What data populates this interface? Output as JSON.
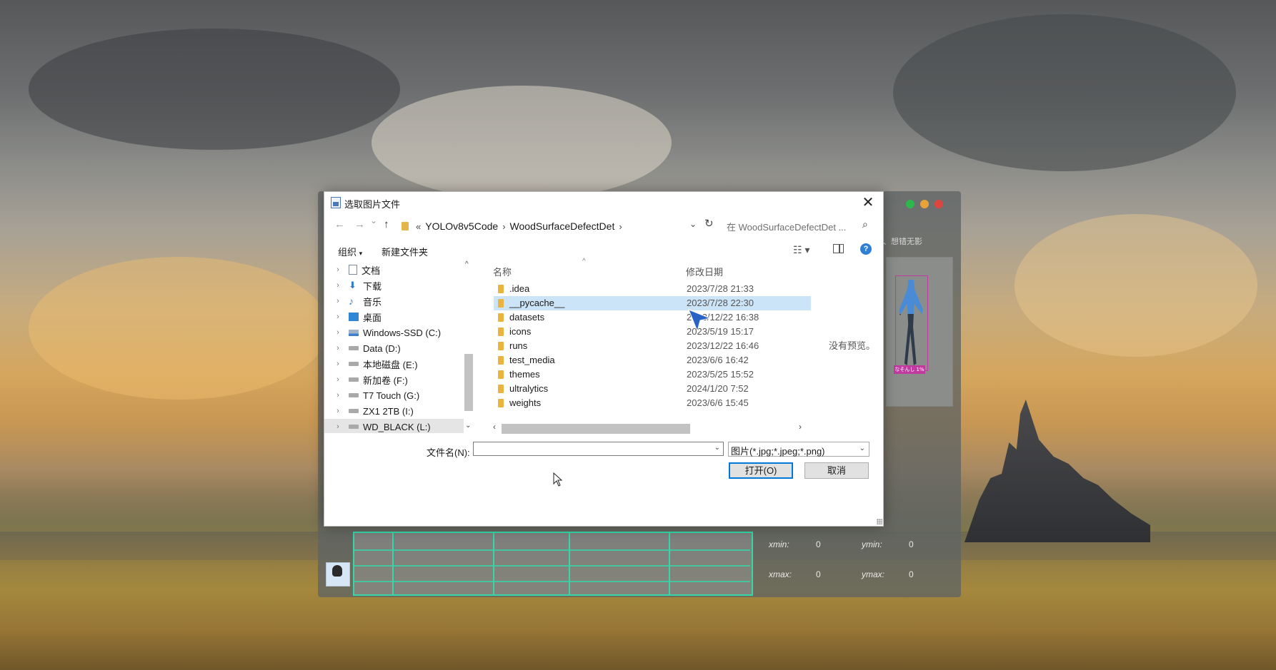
{
  "dialog": {
    "title": "选取图片文件",
    "close_glyph": "✕"
  },
  "navigation": {
    "back_glyph": "←",
    "forward_glyph": "→",
    "history_glyph": "⌄",
    "up_glyph": "↑",
    "crumb_prefix": "«",
    "breadcrumbs": [
      "YOLOv8v5Code",
      "WoodSurfaceDefectDet"
    ],
    "crumb_sep": "›",
    "dropdown_glyph": "⌄",
    "refresh_glyph": "↻",
    "search_placeholder": "在 WoodSurfaceDefectDet ...",
    "search_glyph": "⌕"
  },
  "toolbar": {
    "organize_label": "组织",
    "organize_caret": "▾",
    "new_folder_label": "新建文件夹",
    "view_glyph": "☷ ▾",
    "help_glyph": "?"
  },
  "sidebar": {
    "items": [
      {
        "label": "文档",
        "icon": "document-icon"
      },
      {
        "label": "下载",
        "icon": "download-icon"
      },
      {
        "label": "音乐",
        "icon": "music-icon"
      },
      {
        "label": "桌面",
        "icon": "desktop-icon"
      },
      {
        "label": "Windows-SSD (C:)",
        "icon": "drive-icon"
      },
      {
        "label": "Data (D:)",
        "icon": "drive-icon"
      },
      {
        "label": "本地磁盘 (E:)",
        "icon": "drive-icon"
      },
      {
        "label": "新加卷 (F:)",
        "icon": "drive-icon"
      },
      {
        "label": "T7 Touch (G:)",
        "icon": "drive-icon"
      },
      {
        "label": "ZX1 2TB (I:)",
        "icon": "drive-icon"
      },
      {
        "label": "WD_BLACK (L:)",
        "icon": "drive-icon"
      }
    ],
    "chevron": "›",
    "scroll_up": "^",
    "scroll_down": "⌄"
  },
  "file_list": {
    "col_name": "名称",
    "col_date": "修改日期",
    "sort_caret": "^",
    "rows": [
      {
        "name": ".idea",
        "date": "2023/7/28 21:33"
      },
      {
        "name": "__pycache__",
        "date": "2023/7/28 22:30",
        "selected": true
      },
      {
        "name": "datasets",
        "date": "2023/12/22 16:38"
      },
      {
        "name": "icons",
        "date": "2023/5/19 15:17"
      },
      {
        "name": "runs",
        "date": "2023/12/22 16:46"
      },
      {
        "name": "test_media",
        "date": "2023/6/6 16:42"
      },
      {
        "name": "themes",
        "date": "2023/5/25 15:52"
      },
      {
        "name": "ultralytics",
        "date": "2024/1/20 7:52"
      },
      {
        "name": "weights",
        "date": "2023/6/6 15:45"
      }
    ],
    "no_preview": "没有预览。",
    "hscroll_left": "‹",
    "hscroll_right": "›"
  },
  "footer": {
    "filename_label": "文件名(N):",
    "filename_value": "",
    "filename_arrow": "⌄",
    "filetype_value": "图片(*.jpg;*.jpeg;*.png)",
    "filetype_arrow": "⌄",
    "open_label": "打开(O)",
    "cancel_label": "取消"
  },
  "background_app": {
    "caption": "手、想错无影",
    "detection_label": "なそんし 1%",
    "coords": [
      {
        "label": "xmin:",
        "value": "0"
      },
      {
        "label": "ymin:",
        "value": "0"
      },
      {
        "label": "xmax:",
        "value": "0"
      },
      {
        "label": "ymax:",
        "value": "0"
      }
    ],
    "colors": {
      "close": "#e0443e",
      "min": "#e8a23a",
      "max": "#2db84c",
      "table_border": "#35d6a8"
    }
  }
}
